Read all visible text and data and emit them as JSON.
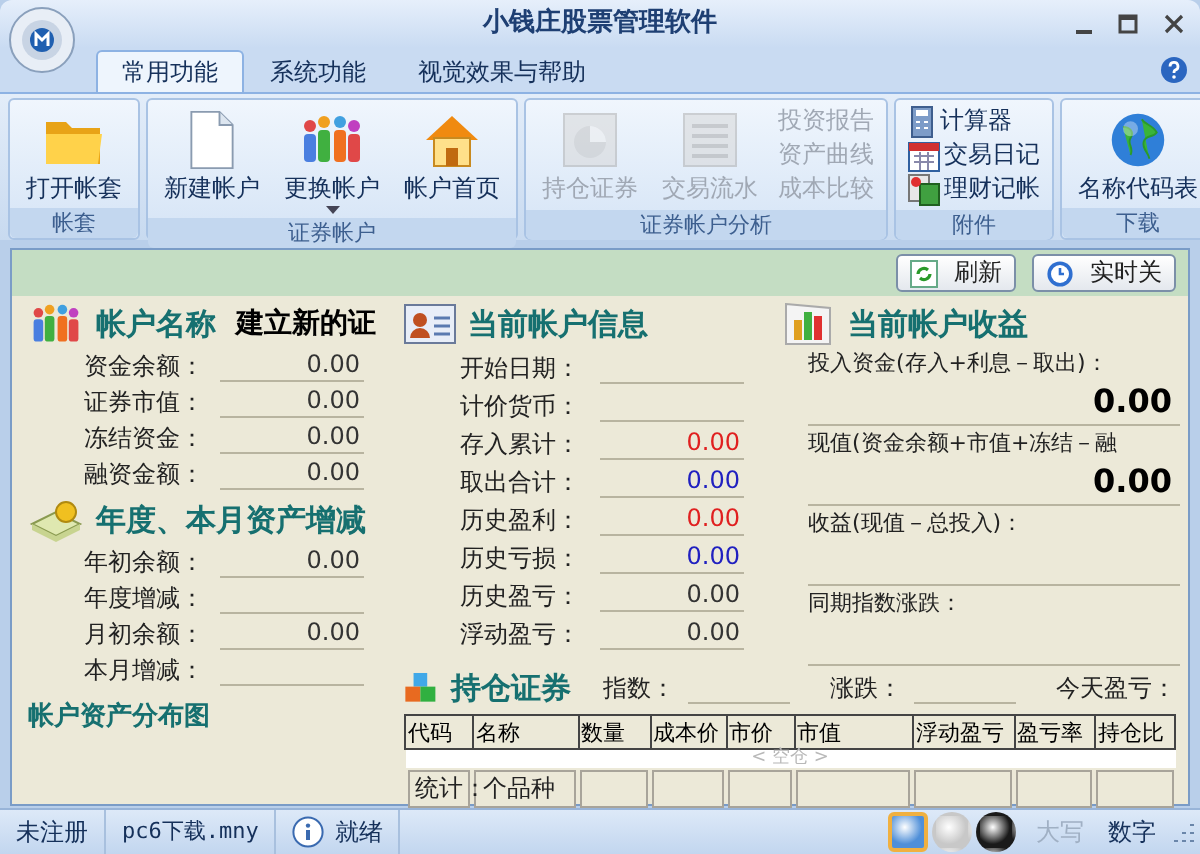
{
  "window": {
    "title": "小钱庄股票管理软件"
  },
  "tabs": [
    {
      "label": "常用功能",
      "selected": true
    },
    {
      "label": "系统功能",
      "selected": false
    },
    {
      "label": "视觉效果与帮助",
      "selected": false
    }
  ],
  "ribbon_groups": [
    {
      "label": "帐套",
      "buttons": [
        {
          "label": "打开帐套",
          "disabled": false,
          "menu": false
        }
      ]
    },
    {
      "label": "证券帐户",
      "buttons": [
        {
          "label": "新建帐户",
          "disabled": false,
          "menu": false
        },
        {
          "label": "更换帐户",
          "disabled": false,
          "menu": true
        },
        {
          "label": "帐户首页",
          "disabled": false,
          "menu": false
        }
      ]
    },
    {
      "label": "证券帐户分析",
      "buttons": [
        {
          "label": "持仓证券",
          "disabled": true,
          "menu": false
        },
        {
          "label": "交易流水",
          "disabled": true,
          "menu": false
        }
      ],
      "small_buttons": [
        {
          "label": "投资报告",
          "disabled": true
        },
        {
          "label": "资产曲线",
          "disabled": true
        },
        {
          "label": "成本比较",
          "disabled": true
        }
      ]
    },
    {
      "label": "附件",
      "small_buttons": [
        {
          "label": "计算器",
          "disabled": false
        },
        {
          "label": "交易日记",
          "disabled": false
        },
        {
          "label": "理财记帐",
          "disabled": false
        }
      ]
    },
    {
      "label": "下载",
      "buttons": [
        {
          "label": "名称代码表",
          "disabled": false,
          "menu": false
        }
      ]
    }
  ],
  "toolbar": {
    "buttons": [
      "刷新",
      "实时关"
    ]
  },
  "account": {
    "label": "帐户名称",
    "value": "建立新的证",
    "fields": [
      {
        "label": "资金余额：",
        "value": "0.00"
      },
      {
        "label": "证券市值：",
        "value": "0.00"
      },
      {
        "label": "冻结资金：",
        "value": "0.00"
      },
      {
        "label": "融资金额：",
        "value": "0.00"
      }
    ]
  },
  "annual": {
    "title": "年度、本月资产增减",
    "fields": [
      {
        "label": "年初余额：",
        "value": "0.00"
      },
      {
        "label": "年度增减："
      },
      {
        "label": "月初余额：",
        "value": "0.00"
      },
      {
        "label": "本月增减："
      }
    ]
  },
  "distribution": {
    "title": "帐户资产分布图"
  },
  "account_info": {
    "title": "当前帐户信息",
    "fields": [
      {
        "label": "开始日期："
      },
      {
        "label": "计价货币："
      },
      {
        "label": "存入累计：",
        "value": "0.00",
        "color": "#e02020"
      },
      {
        "label": "取出合计：",
        "value": "0.00",
        "color": "#2020c0"
      },
      {
        "label": "历史盈利：",
        "value": "0.00",
        "color": "#e02020"
      },
      {
        "label": "历史亏损：",
        "value": "0.00",
        "color": "#2020c0"
      },
      {
        "label": "历史盈亏：",
        "value": "0.00",
        "color": "#333333"
      },
      {
        "label": "浮动盈亏：",
        "value": "0.00",
        "color": "#333333"
      }
    ]
  },
  "income": {
    "title": "当前帐户收益",
    "fields": [
      {
        "label": "投入资金(存入+利息－取出)：",
        "value": "0.00"
      },
      {
        "label": "现值(资金余额+市值+冻结－融",
        "value": "0.00"
      },
      {
        "label": "收益(现值－总投入)："
      },
      {
        "label": "同期指数涨跌："
      }
    ]
  },
  "holdings": {
    "title": "持仓证券",
    "index_label": "指数：",
    "change_label": "涨跌：",
    "today_label": "今天盈亏：",
    "table": {
      "columns": [
        "代码",
        "名称",
        "数量",
        "成本价",
        "市价",
        "市值",
        "浮动盈亏",
        "盈亏率",
        "持仓比"
      ],
      "empty_message": "< 空仓 >",
      "totals": {
        "label": "统计：",
        "count_label": "个品种"
      }
    }
  },
  "status_bar": {
    "items": [
      "未注册",
      "pc6下载.mny",
      "就绪"
    ],
    "theme_buttons": [
      {
        "selected": true,
        "color": "#4f8fd8"
      },
      {
        "selected": false,
        "color": "#c8c8c8"
      },
      {
        "selected": false,
        "color": "#1a1a1a"
      }
    ],
    "indicators": [
      {
        "label": "大写",
        "on": false
      },
      {
        "label": "数字",
        "on": true
      }
    ]
  }
}
